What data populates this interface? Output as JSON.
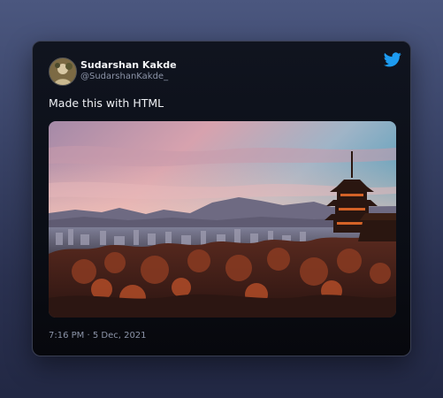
{
  "tweet": {
    "author_name": "Sudarshan Kakde",
    "author_handle": "@SudarshanKakde_",
    "text": "Made this with HTML",
    "timestamp": "7:16 PM · 5 Dec, 2021",
    "brand_color": "#1d9bf0",
    "logo_icon": "twitter-bird-icon",
    "media_subject": "pagoda-sunset-photo"
  }
}
